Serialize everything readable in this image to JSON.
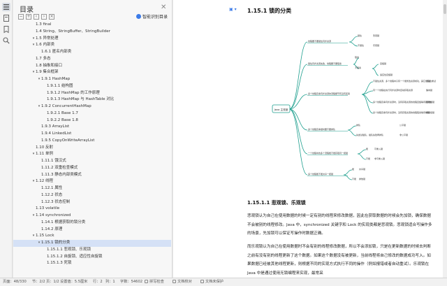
{
  "toc": {
    "title": "目录",
    "smart_toc_label": "智能识别目录",
    "items": [
      {
        "label": "1.3 final",
        "indent": 0,
        "toggle": ""
      },
      {
        "label": "1.4 String、StringBuffer、StringBuilder",
        "indent": 0,
        "toggle": ""
      },
      {
        "label": "1.5 异常处理",
        "indent": 0,
        "toggle": "▾"
      },
      {
        "label": "1.6 内部类",
        "indent": 0,
        "toggle": "▾"
      },
      {
        "label": "1.6.1 匿名内部类",
        "indent": 1,
        "toggle": ""
      },
      {
        "label": "1.7 多态",
        "indent": 0,
        "toggle": ""
      },
      {
        "label": "1.8 抽象和接口",
        "indent": 0,
        "toggle": ""
      },
      {
        "label": "1.9 集合框架",
        "indent": 0,
        "toggle": "▾"
      },
      {
        "label": "1.9.1 HashMap",
        "indent": 1,
        "toggle": "▾"
      },
      {
        "label": "1.9.1.1 结构图",
        "indent": 2,
        "toggle": ""
      },
      {
        "label": "1.9.1.2 HashMap 的工作原理",
        "indent": 2,
        "toggle": ""
      },
      {
        "label": "1.9.1.3 HashMap 与 HashTable 对比",
        "indent": 2,
        "toggle": ""
      },
      {
        "label": "1.9.2 ConcurrentHashMap",
        "indent": 1,
        "toggle": "▾"
      },
      {
        "label": "1.9.2.1 Base 1.7",
        "indent": 2,
        "toggle": ""
      },
      {
        "label": "1.9.2.2 Base 1.8",
        "indent": 2,
        "toggle": ""
      },
      {
        "label": "1.9.3 ArrayList",
        "indent": 1,
        "toggle": ""
      },
      {
        "label": "1.9.4 LinkedList",
        "indent": 1,
        "toggle": ""
      },
      {
        "label": "1.9.5 CopyOnWriteArrayList",
        "indent": 1,
        "toggle": ""
      },
      {
        "label": "1.10 反射",
        "indent": 0,
        "toggle": ""
      },
      {
        "label": "1.11 单例",
        "indent": 0,
        "toggle": "▾"
      },
      {
        "label": "1.11.1 饿汉式",
        "indent": 1,
        "toggle": ""
      },
      {
        "label": "1.11.2 双重检查模式",
        "indent": 1,
        "toggle": ""
      },
      {
        "label": "1.11.3 静态内部类模式",
        "indent": 1,
        "toggle": ""
      },
      {
        "label": "1.12 线程",
        "indent": 0,
        "toggle": "▾"
      },
      {
        "label": "1.12.1 属性",
        "indent": 1,
        "toggle": ""
      },
      {
        "label": "1.12.2 状态",
        "indent": 1,
        "toggle": ""
      },
      {
        "label": "1.12.3 状态控制",
        "indent": 1,
        "toggle": ""
      },
      {
        "label": "1.13 volatile",
        "indent": 0,
        "toggle": ""
      },
      {
        "label": "1.14 synchronized",
        "indent": 0,
        "toggle": "▾"
      },
      {
        "label": "1.14.1 根据获取的锁分类",
        "indent": 1,
        "toggle": ""
      },
      {
        "label": "1.14.2 原理",
        "indent": 1,
        "toggle": ""
      },
      {
        "label": "1.15 Lock",
        "indent": 0,
        "toggle": "▾"
      },
      {
        "label": "1.15.1 锁的分类",
        "indent": 1,
        "toggle": "▾",
        "selected": true
      },
      {
        "label": "1.15.1.1 悲观锁、乐观锁",
        "indent": 2,
        "toggle": ""
      },
      {
        "label": "1.15.1.2 自旋锁、适应性自旋锁",
        "indent": 2,
        "toggle": ""
      },
      {
        "label": "1.15.1.3 死锁",
        "indent": 2,
        "toggle": ""
      }
    ]
  },
  "doc": {
    "heading": "1.15.1 锁的分类",
    "subheading": "1.15.1.1 悲观锁、乐观锁",
    "paragraph1": "悲观锁认为自己在使用数据的时候一定有别的线程来修改数据，因此在获取数据的时候会先加锁，确保数据不会被别的线程修改。Java 中，synchronized 关键字和 Lock 的实现类都是悲观锁。悲观锁适合写操作多的场景，先加锁可以保证写操作时数据正确。",
    "paragraph2": "而乐观锁认为自己在使用数据时不会有别的线程修改数据，所以不会添加锁，只是在更新数据的时候去判断之前有没有别的线程更新了这个数据。如果这个数据没有被更新，当前线程将自己修改的数据成功写入。如果数据已经被其他线程更新，则根据不同的实现方式执行不同的操作（例如报错或者自动重试）。乐观锁在 Java 中是通过使用无锁编程来实现，最常采"
  },
  "mindmap": {
    "center": "Java 主流锁",
    "branches": [
      {
        "q": "线程要不要锁住同步资源",
        "leaves": [
          "锁住",
          "不锁住"
        ],
        "results": [
          "悲观锁",
          "乐观锁"
        ]
      },
      {
        "q": "锁住同步资源失败，线程要不要阻塞",
        "leaves": [
          "阻塞",
          "不阻塞"
        ],
        "results": [
          "",
          "自旋锁",
          "适应性自旋锁"
        ]
      },
      {
        "q": "多个线程竞争同步资源的流程细节有没有区别",
        "leaves": [
          "不锁住资源，多个线程中只有一个能修改资源成功，其它线程会重试",
          "同一个线程在执行同步资源时自动获取资源",
          "多个线程竞争同步资源时，没有获取资源的线程自旋等待锁释放",
          "多个线程竞争同步资源时，没有获取资源的线程阻塞等待唤醒"
        ],
        "results": [
          "无锁",
          "偏向锁",
          "轻量级锁",
          "重量级锁"
        ]
      },
      {
        "q": "多个线程竞争锁时要不要排队",
        "leaves": [
          "排队",
          "先尝试插队，插队失败再排队"
        ],
        "results": [
          "公平锁",
          "非公平锁"
        ]
      },
      {
        "q": "一个线程中的多个流程能不能获取同一把锁",
        "leaves": [
          "能",
          "不能"
        ],
        "results": [
          "可重入锁",
          "非可重入锁"
        ]
      },
      {
        "q": "多个线程能不能共享一把锁",
        "leaves": [
          "能",
          "不能"
        ],
        "results": [
          "共享锁",
          "排他锁"
        ]
      }
    ]
  },
  "status": {
    "page": "页面：48/330",
    "section": "节：2/2",
    "section_page": "页：1/2",
    "setting": "设置值：5.5厘米",
    "row": "行：2",
    "column": "列：1",
    "word_count": "字数：54602",
    "spell_check": "拼写检查",
    "doc_check": "文档校对",
    "doc_protect": "文档未保护"
  }
}
